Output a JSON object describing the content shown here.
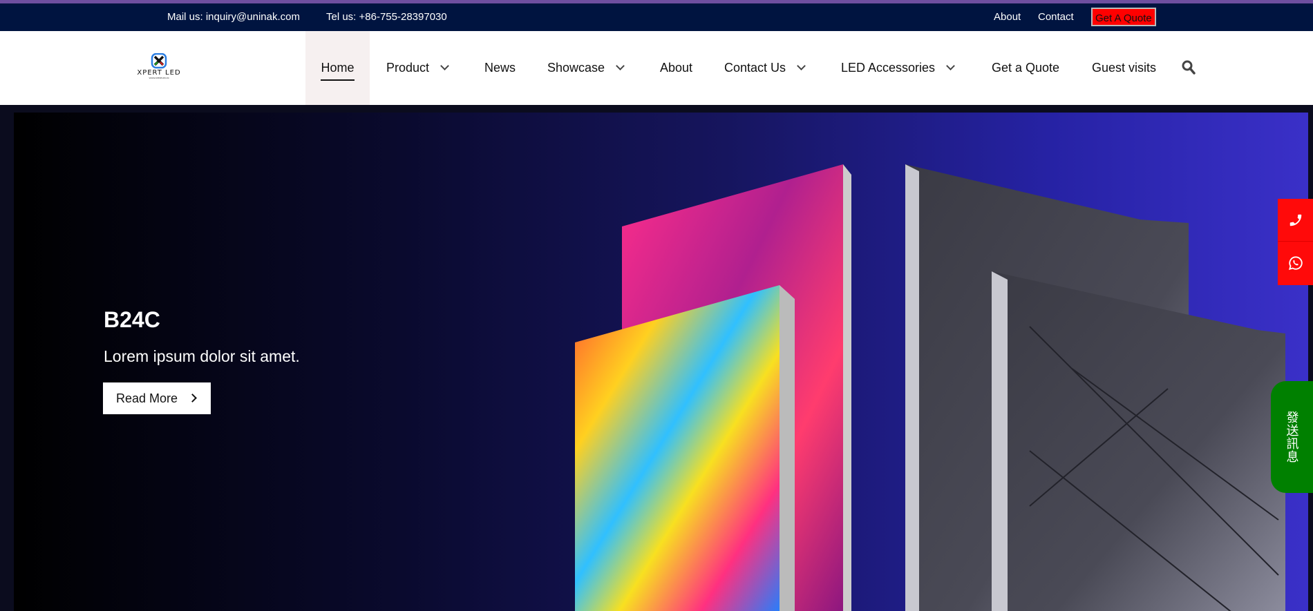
{
  "topbar": {
    "mail": "Mail us: inquiry@uninak.com",
    "tel": "Tel us: +86-755-28397030",
    "links": [
      "About",
      "Contact"
    ],
    "quote": "Get A Quote"
  },
  "logo": {
    "text": "XPERT LED",
    "sub": "WWW.XPERTLED.IN"
  },
  "nav": {
    "items": [
      {
        "label": "Home",
        "active": true
      },
      {
        "label": "Product",
        "dropdown": true
      },
      {
        "label": "News"
      },
      {
        "label": "Showcase",
        "dropdown": true
      },
      {
        "label": "About"
      },
      {
        "label": "Contact Us",
        "dropdown": true
      },
      {
        "label": "LED Accessories",
        "dropdown": true
      },
      {
        "label": "Get a Quote"
      },
      {
        "label": "Guest visits"
      }
    ],
    "search_icon": "search-icon"
  },
  "hero": {
    "title": "B24C",
    "subtitle": "Lorem ipsum dolor sit amet.",
    "button": "Read More"
  },
  "side": {
    "phone_icon": "phone-icon",
    "whatsapp_icon": "whatsapp-icon",
    "message": "發送訊息"
  },
  "colors": {
    "topbar": "#001440",
    "quote": "#ff0000",
    "side_red": "#ff0a0a",
    "side_green": "#008000"
  }
}
